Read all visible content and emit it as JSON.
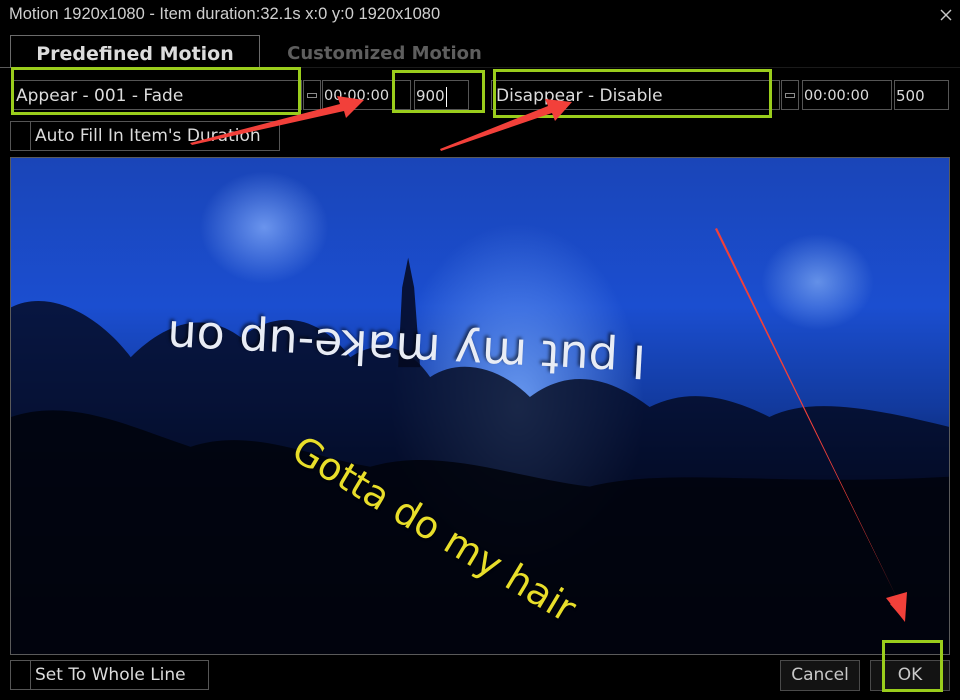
{
  "window": {
    "title": "Motion 1920x1080 - Item duration:32.1s x:0 y:0 1920x1080",
    "close_icon": "close-icon"
  },
  "tabs": [
    {
      "label": "Predefined Motion",
      "active": true
    },
    {
      "label": "Customized Motion",
      "active": false
    }
  ],
  "appear": {
    "effect": "Appear - 001 - Fade",
    "start_time": "00:00:00",
    "duration": "900"
  },
  "disappear": {
    "effect": "Disappear - Disable",
    "start_time": "00:00:00",
    "duration": "500"
  },
  "options": {
    "auto_fill_label": "Auto Fill In Item's Duration",
    "auto_fill_checked": false,
    "whole_line_label": "Set To Whole Line",
    "whole_line_checked": false
  },
  "preview": {
    "lyric_line_1": "I put my make-up on",
    "lyric_line_2": "Gotta do my hair"
  },
  "buttons": {
    "cancel": "Cancel",
    "ok": "OK"
  },
  "annotation_colors": {
    "highlight": "#9acd1c",
    "arrow": "#f2403a"
  }
}
